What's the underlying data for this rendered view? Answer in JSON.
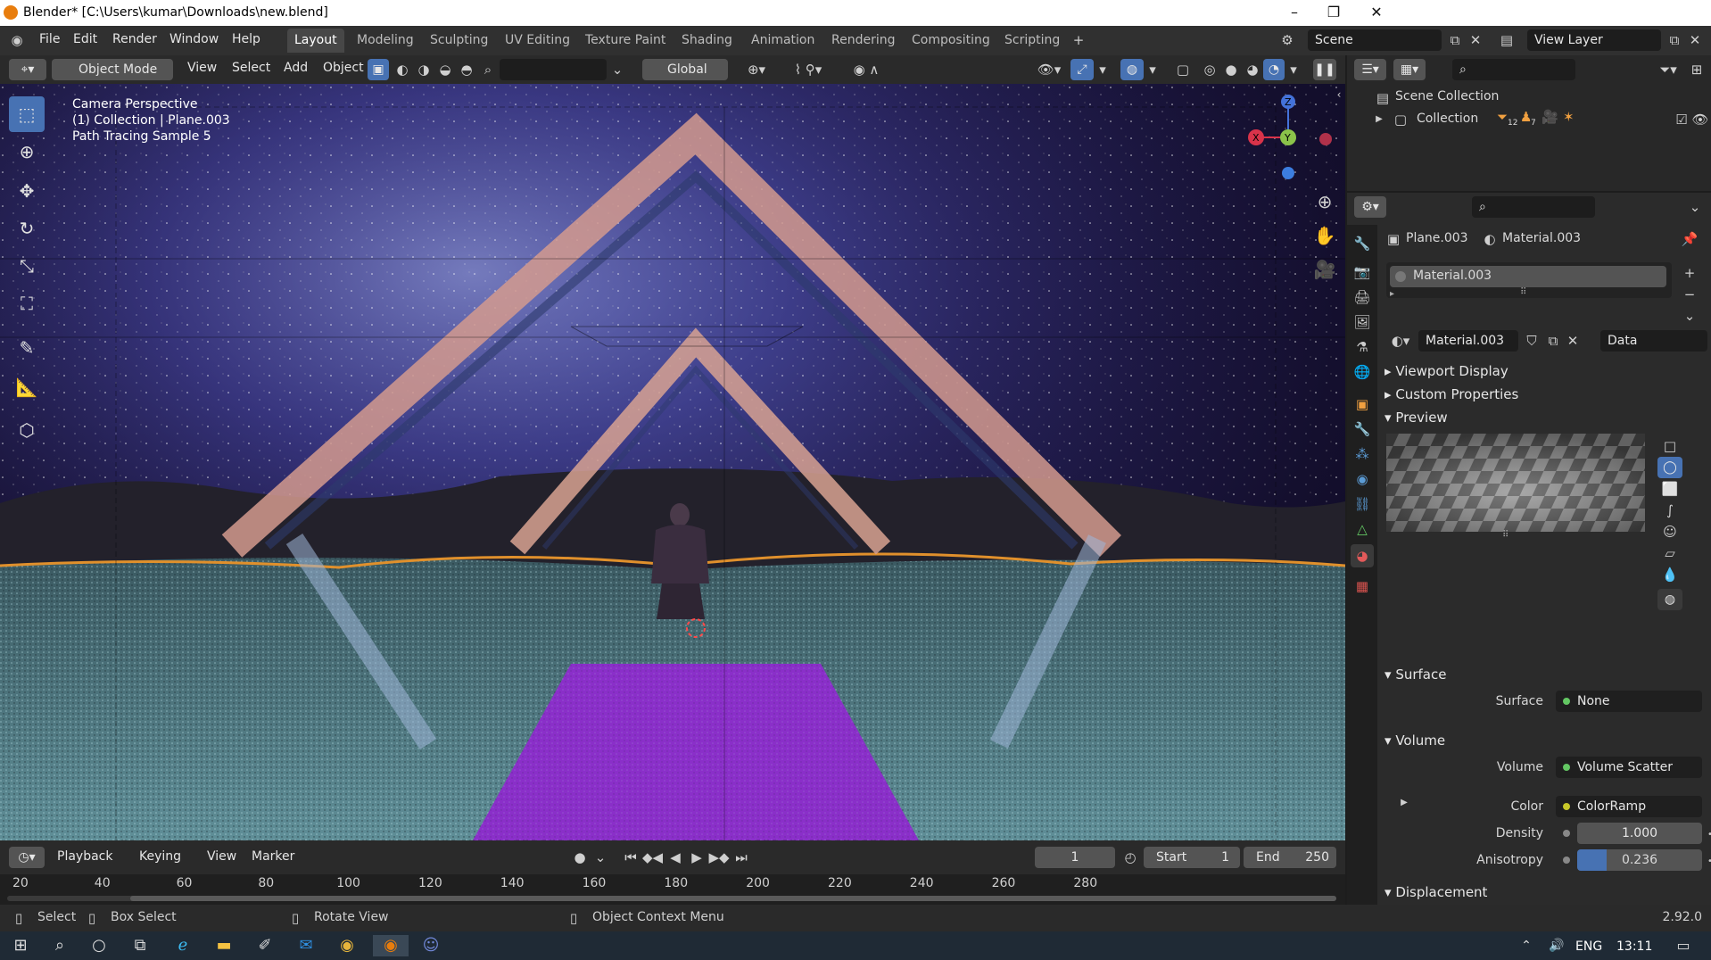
{
  "window": {
    "title": "Blender* [C:\\Users\\kumar\\Downloads\\new.blend]"
  },
  "topbar": {
    "menus": [
      "File",
      "Edit",
      "Render",
      "Window",
      "Help"
    ],
    "workspaces": [
      "Layout",
      "Modeling",
      "Sculpting",
      "UV Editing",
      "Texture Paint",
      "Shading",
      "Animation",
      "Rendering",
      "Compositing",
      "Scripting"
    ],
    "active_workspace": "Layout",
    "scene": "Scene",
    "view_layer": "View Layer"
  },
  "viewport_header": {
    "mode": "Object Mode",
    "menus": [
      "View",
      "Select",
      "Add",
      "Object"
    ],
    "orientation": "Global"
  },
  "viewport": {
    "overlay_lines": [
      "Camera Perspective",
      "(1) Collection | Plane.003",
      "Path Tracing Sample 5"
    ]
  },
  "timeline": {
    "menus": [
      "Playback",
      "Keying",
      "View",
      "Marker"
    ],
    "current_frame": "1",
    "start_label": "Start",
    "start": "1",
    "end_label": "End",
    "end": "250",
    "ticks": [
      "20",
      "40",
      "60",
      "80",
      "100",
      "120",
      "140",
      "160",
      "180",
      "200",
      "220",
      "240",
      "260",
      "280"
    ]
  },
  "status": {
    "select": "Select",
    "box_select": "Box Select",
    "rotate": "Rotate View",
    "context": "Object Context Menu",
    "version": "2.92.0"
  },
  "outliner": {
    "scene_collection": "Scene Collection",
    "collection": "Collection",
    "badge_a": "12",
    "badge_b": "7"
  },
  "properties": {
    "object": "Plane.003",
    "material": "Material.003",
    "slot": "Material.003",
    "datablock": "Material.003",
    "link": "Data",
    "panels": {
      "viewport_display": "Viewport Display",
      "custom_properties": "Custom Properties",
      "preview": "Preview",
      "surface": "Surface",
      "volume": "Volume",
      "displacement": "Displacement"
    },
    "surface_label": "Surface",
    "surface_value": "None",
    "volume_label": "Volume",
    "volume_value": "Volume Scatter",
    "color_label": "Color",
    "color_value": "ColorRamp",
    "density_label": "Density",
    "density_value": "1.000",
    "anisotropy_label": "Anisotropy",
    "anisotropy_value": "0.236",
    "anisotropy_fraction": 0.236
  },
  "taskbar": {
    "lang": "ENG",
    "time": "13:11"
  },
  "colors": {
    "accent": "#4772b3",
    "purple_floor": "#8a2fc9",
    "horizon": "#e0902c"
  }
}
